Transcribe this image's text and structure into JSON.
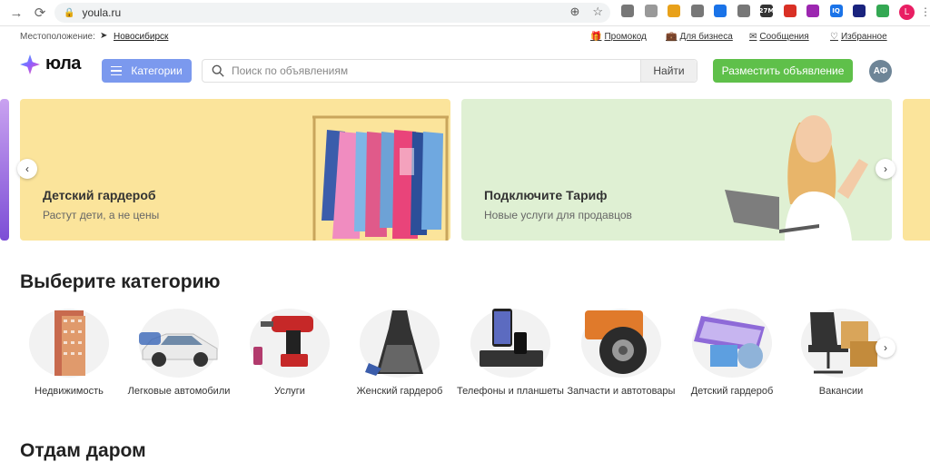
{
  "browser": {
    "url": "youla.ru",
    "profile_initial": "L",
    "extensions": [
      {
        "name": "ext-1",
        "color": "#777"
      },
      {
        "name": "ext-2",
        "color": "#999"
      },
      {
        "name": "ext-3",
        "color": "#e8a11a"
      },
      {
        "name": "ext-4",
        "color": "#777"
      },
      {
        "name": "ext-5",
        "color": "#1a73e8"
      },
      {
        "name": "ext-6",
        "color": "#777"
      },
      {
        "name": "ext-7",
        "color": "#333",
        "badge": "27M"
      },
      {
        "name": "ext-8",
        "color": "#d93025"
      },
      {
        "name": "ext-9",
        "color": "#9c27b0"
      },
      {
        "name": "ext-10",
        "color": "#1a73e8",
        "badge": "IQ"
      },
      {
        "name": "ext-11",
        "color": "#1a237e"
      },
      {
        "name": "ext-12",
        "color": "#34a853"
      }
    ]
  },
  "utility": {
    "location_label": "Местоположение:",
    "location_city": "Новосибирск",
    "links": [
      "Промокод",
      "Для бизнеса",
      "Сообщения",
      "Избранное"
    ]
  },
  "header": {
    "logo_text": "юла",
    "categories_label": "Категории",
    "search_placeholder": "Поиск по объявлениям",
    "find_label": "Найти",
    "place_ad_label": "Разместить объявление",
    "avatar_initials": "АФ"
  },
  "banners": [
    {
      "title": "Детский гардероб",
      "subtitle": "Растут дети, а не цены"
    },
    {
      "title": "Подключите Тариф",
      "subtitle": "Новые услуги для продавцов"
    }
  ],
  "section": {
    "title": "Выберите категорию",
    "categories": [
      {
        "label": "Недвижимость"
      },
      {
        "label": "Легковые автомобили"
      },
      {
        "label": "Услуги"
      },
      {
        "label": "Женский гардероб"
      },
      {
        "label": "Телефоны и планшеты"
      },
      {
        "label": "Запчасти и автотовары"
      },
      {
        "label": "Детский гардероб"
      },
      {
        "label": "Вакансии"
      }
    ]
  },
  "gift_section": {
    "title": "Отдам даром"
  },
  "colors": {
    "accent": "#7b99ee",
    "cta": "#5fc04a"
  }
}
